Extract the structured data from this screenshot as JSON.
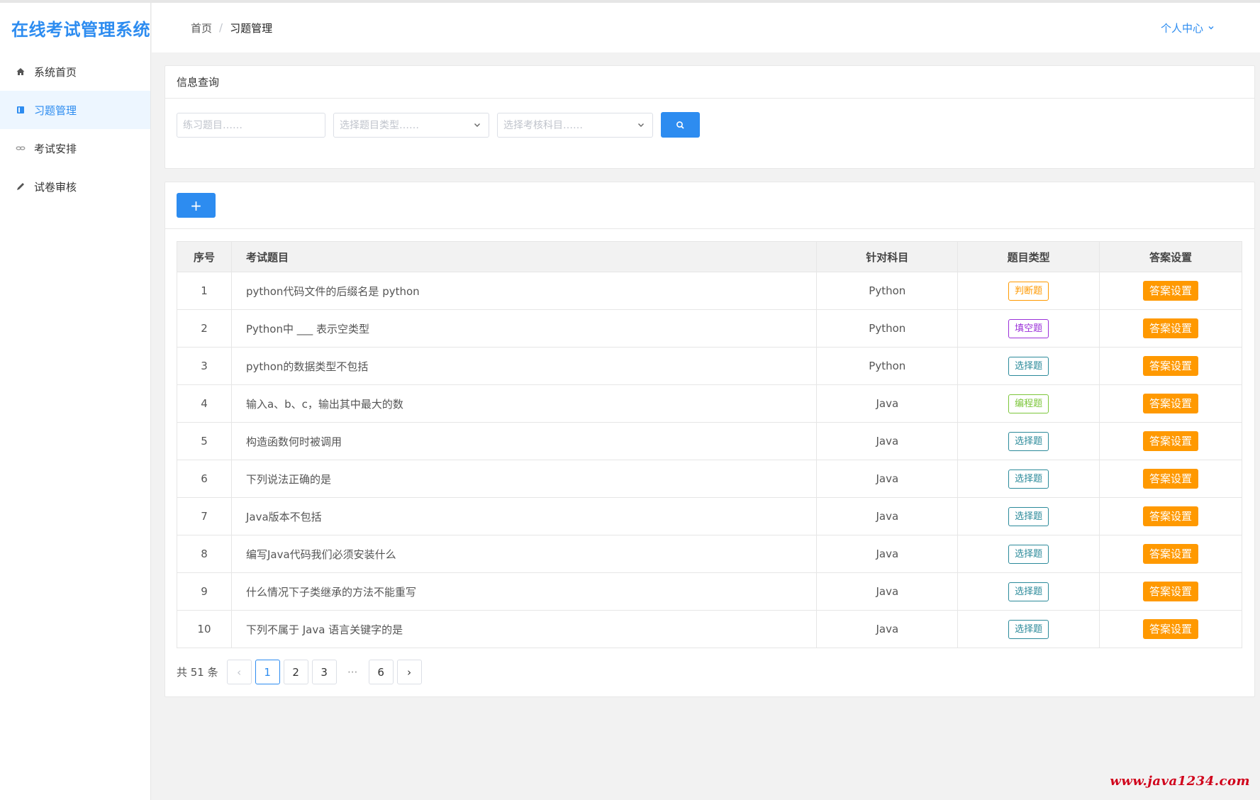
{
  "app": {
    "title": "在线考试管理系统"
  },
  "sidebar": {
    "items": [
      {
        "label": "系统首页",
        "icon": "home-icon"
      },
      {
        "label": "习题管理",
        "icon": "book-icon",
        "active": true
      },
      {
        "label": "考试安排",
        "icon": "link-icon"
      },
      {
        "label": "试卷审核",
        "icon": "pencil-icon"
      }
    ]
  },
  "header": {
    "breadcrumb": {
      "home": "首页",
      "separator": "/",
      "current": "习题管理"
    },
    "user_menu": "个人中心"
  },
  "query": {
    "title": "信息查询",
    "question_placeholder": "练习题目……",
    "type_placeholder": "选择题目类型……",
    "subject_placeholder": "选择考核科目……"
  },
  "toolbar": {
    "add_label": "+"
  },
  "table": {
    "columns": [
      "序号",
      "考试题目",
      "针对科目",
      "题目类型",
      "答案设置"
    ],
    "rows": [
      {
        "idx": "1",
        "question": "python代码文件的后缀名是 python",
        "subject": "Python",
        "type": "判断题",
        "action": "答案设置"
      },
      {
        "idx": "2",
        "question": "Python中 ___ 表示空类型",
        "subject": "Python",
        "type": "填空题",
        "action": "答案设置"
      },
      {
        "idx": "3",
        "question": "python的数据类型不包括",
        "subject": "Python",
        "type": "选择题",
        "action": "答案设置"
      },
      {
        "idx": "4",
        "question": "输入a、b、c，输出其中最大的数",
        "subject": "Java",
        "type": "编程题",
        "action": "答案设置"
      },
      {
        "idx": "5",
        "question": "构造函数何时被调用",
        "subject": "Java",
        "type": "选择题",
        "action": "答案设置"
      },
      {
        "idx": "6",
        "question": "下列说法正确的是",
        "subject": "Java",
        "type": "选择题",
        "action": "答案设置"
      },
      {
        "idx": "7",
        "question": "Java版本不包括",
        "subject": "Java",
        "type": "选择题",
        "action": "答案设置"
      },
      {
        "idx": "8",
        "question": "编写Java代码我们必须安装什么",
        "subject": "Java",
        "type": "选择题",
        "action": "答案设置"
      },
      {
        "idx": "9",
        "question": "什么情况下子类继承的方法不能重写",
        "subject": "Java",
        "type": "选择题",
        "action": "答案设置"
      },
      {
        "idx": "10",
        "question": "下列不属于 Java 语言关键字的是",
        "subject": "Java",
        "type": "选择题",
        "action": "答案设置"
      }
    ]
  },
  "tag_colors": {
    "判断题": "#ff9900",
    "填空题": "#9b30d9",
    "选择题": "#2b8a9a",
    "编程题": "#7cc63a"
  },
  "pagination": {
    "total_text": "共 51 条",
    "prev": "‹",
    "next": "›",
    "pages": [
      "1",
      "2",
      "3"
    ],
    "ellipsis": "···",
    "last": "6",
    "current": "1"
  },
  "watermark": "www.java1234.com",
  "colors": {
    "primary": "#2d8cf0",
    "warning": "#ff9900"
  }
}
